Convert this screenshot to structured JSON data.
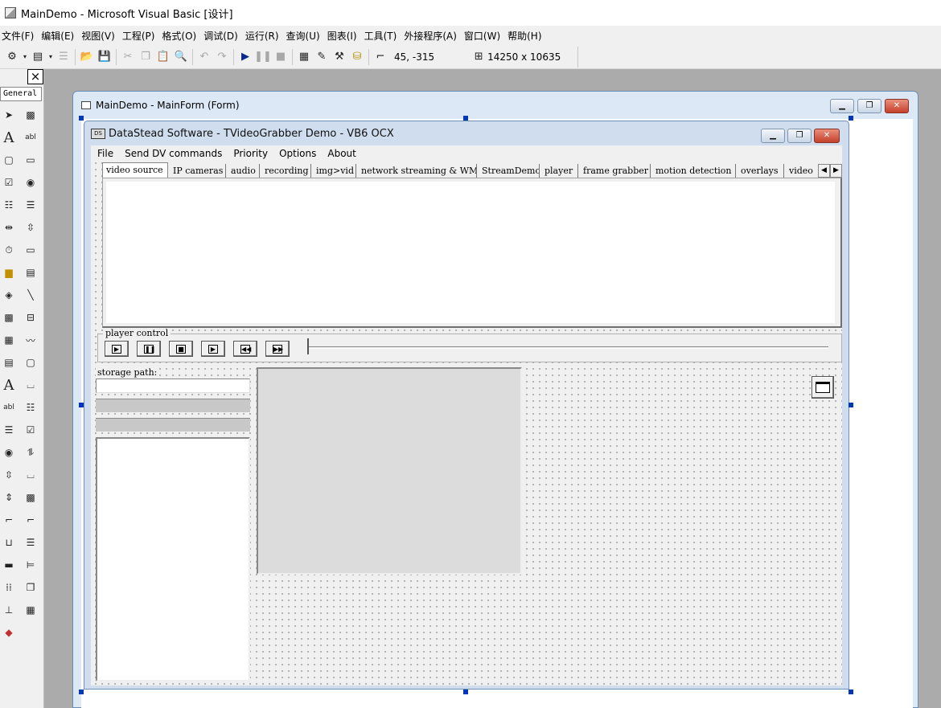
{
  "ide": {
    "title": "MainDemo - Microsoft Visual Basic [设计]",
    "menu": [
      "文件(F)",
      "编辑(E)",
      "视图(V)",
      "工程(P)",
      "格式(O)",
      "调试(D)",
      "运行(R)",
      "查询(U)",
      "图表(I)",
      "工具(T)",
      "外接程序(A)",
      "窗口(W)",
      "帮助(H)"
    ],
    "toolbar": {
      "position": "45, -315",
      "size": "14250 x 10635"
    }
  },
  "toolbox": {
    "close_label": "×",
    "tab_label": "General"
  },
  "designer": {
    "title": "MainDemo - MainForm (Form)"
  },
  "form": {
    "title": "DataStead Software - TVideoGrabber Demo - VB6 OCX",
    "menu": [
      "File",
      "Send DV commands",
      "Priority",
      "Options",
      "About"
    ],
    "tabs": [
      "video source",
      "IP cameras",
      "audio",
      "recording",
      "img>vid",
      "network streaming & WMV",
      "StreamDemos",
      "player",
      "frame grabber",
      "motion detection",
      "overlays",
      "video"
    ],
    "player_control_label": "player control",
    "storage_label": "storage path:"
  },
  "colors": {
    "designer_frame": "#dce8f5",
    "form_frame": "#cfddef",
    "mdi_background": "#ababab",
    "handle": "#0037b5"
  }
}
